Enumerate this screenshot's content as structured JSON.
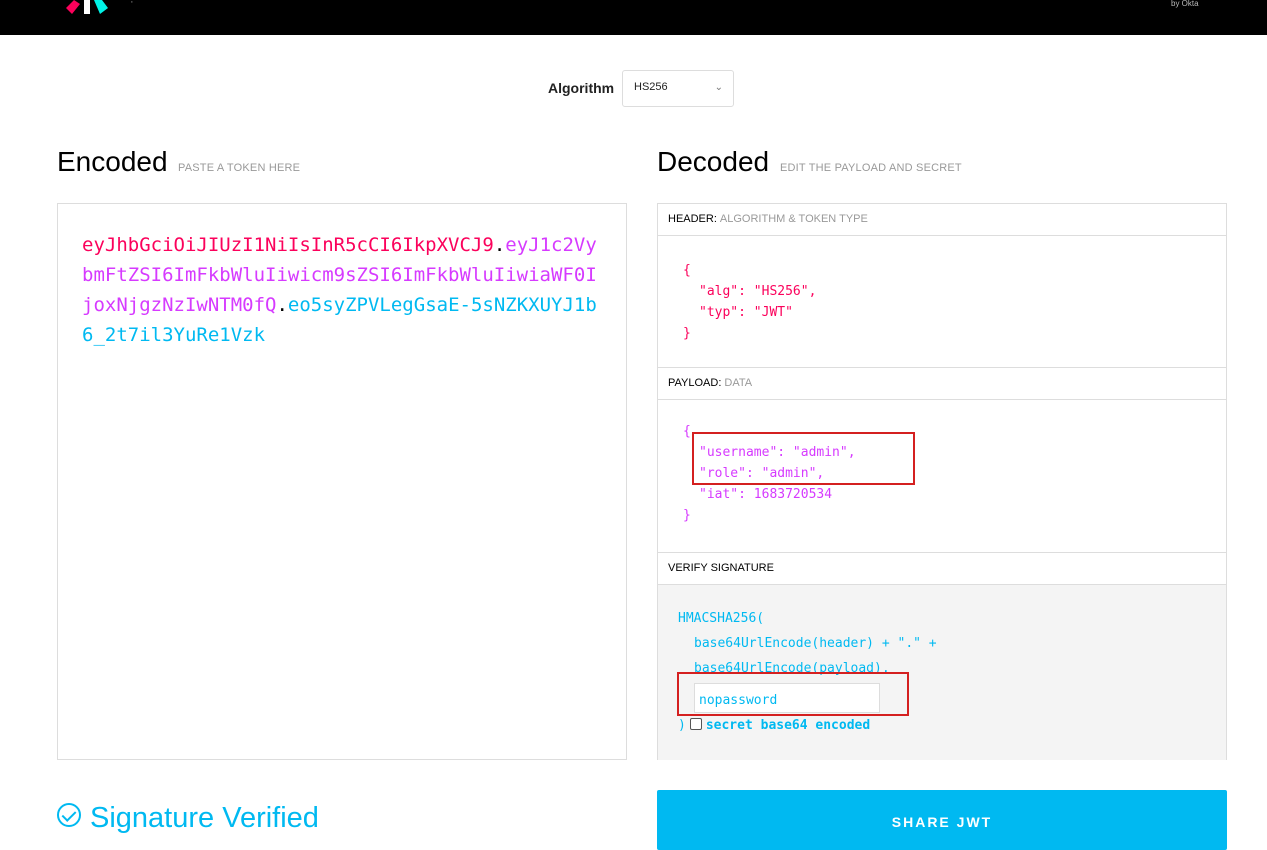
{
  "topbar": {
    "by_label": "by Okta"
  },
  "algorithm": {
    "label": "Algorithm",
    "selected": "HS256"
  },
  "encoded": {
    "title": "Encoded",
    "subtitle": "PASTE A TOKEN HERE",
    "token_header": "eyJhbGciOiJIUzI1NiIsInR5cCI6IkpXVCJ9",
    "token_payload": "eyJ1c2VybmFtZSI6ImFkbWluIiwicm9sZSI6ImFkbWluIiwiaWF0IjoxNjgzNzIwNTM0fQ",
    "token_signature": "eo5syZPVLegGsaE-5sNZKXUYJ1b6_2t7il3YuRe1Vzk",
    "dot": "."
  },
  "decoded": {
    "title": "Decoded",
    "subtitle": "EDIT THE PAYLOAD AND SECRET",
    "header_section": {
      "label": "HEADER:",
      "sublabel": "ALGORITHM & TOKEN TYPE",
      "lines": [
        "{",
        "\"alg\": \"HS256\",",
        "\"typ\": \"JWT\"",
        "}"
      ]
    },
    "payload_section": {
      "label": "PAYLOAD:",
      "sublabel": "DATA",
      "lines": [
        "{",
        "\"username\": \"admin\",",
        "\"role\": \"admin\",",
        "\"iat\": 1683720534",
        "}"
      ]
    },
    "signature_section": {
      "label": "VERIFY SIGNATURE",
      "line1": "HMACSHA256(",
      "line2": "base64UrlEncode(header) + \".\" +",
      "line3": "base64UrlEncode(payload),",
      "secret_value": "nopassword",
      "close": ")",
      "b64_label": "secret base64 encoded"
    }
  },
  "status": {
    "verified": "Signature Verified"
  },
  "share": {
    "label": "SHARE JWT"
  },
  "colors": {
    "header": "#fb015b",
    "payload": "#d63aff",
    "signature": "#00b9f1",
    "highlight": "#d42020"
  }
}
